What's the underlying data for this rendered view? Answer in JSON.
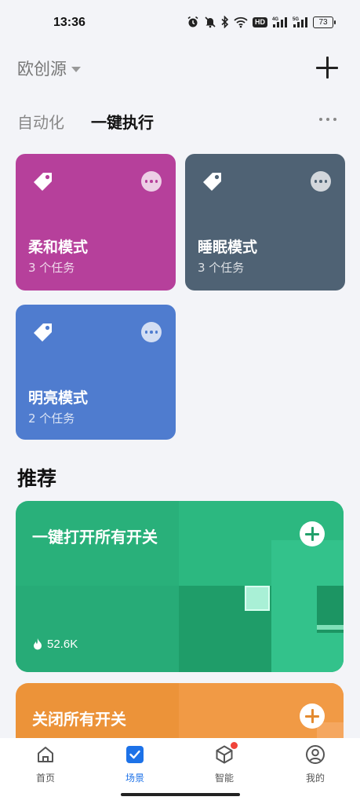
{
  "status": {
    "time": "13:36",
    "hd": "HD",
    "battery": "73"
  },
  "header": {
    "home_name": "欧创源"
  },
  "tabs": {
    "automation": "自动化",
    "one_click": "一键执行"
  },
  "scenes": [
    {
      "name": "柔和模式",
      "count": "3 个任务",
      "color": "#b6409b"
    },
    {
      "name": "睡眠模式",
      "count": "3 个任务",
      "color": "#4f6274"
    },
    {
      "name": "明亮模式",
      "count": "2 个任务",
      "color": "#4f7ccf"
    }
  ],
  "recommend": {
    "title": "推荐",
    "items": [
      {
        "title": "一键打开所有开关",
        "likes": "52.6K",
        "color": "#29b07a"
      },
      {
        "title": "关闭所有开关",
        "color": "#ec9339"
      }
    ]
  },
  "nav": [
    {
      "label": "首页",
      "icon": "home-icon"
    },
    {
      "label": "场景",
      "icon": "scene-icon",
      "active": true
    },
    {
      "label": "智能",
      "icon": "smart-cube-icon",
      "badge": true
    },
    {
      "label": "我的",
      "icon": "profile-icon"
    }
  ]
}
